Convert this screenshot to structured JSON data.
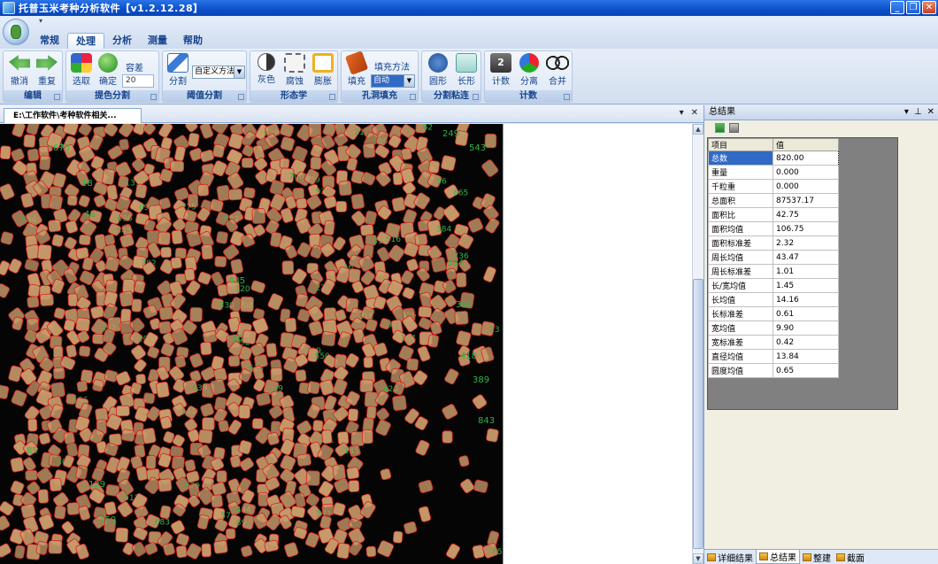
{
  "window": {
    "title": "托普玉米考种分析软件【v1.2.12.28】"
  },
  "menu_tabs": [
    {
      "label": "常规",
      "active": false
    },
    {
      "label": "处理",
      "active": true
    },
    {
      "label": "分析",
      "active": false
    },
    {
      "label": "测量",
      "active": false
    },
    {
      "label": "帮助",
      "active": false
    }
  ],
  "ribbon": {
    "edit": {
      "group": "编辑",
      "undo": "撤消",
      "redo": "重复"
    },
    "color_seg": {
      "group": "提色分割",
      "pick": "选取",
      "confirm": "确定",
      "tolerance_label": "容差",
      "tolerance_value": "20"
    },
    "threshold": {
      "group": "阈值分割",
      "split": "分割",
      "method": "自定义方法"
    },
    "morphology": {
      "group": "形态学",
      "gray": "灰色",
      "erode": "腐蚀",
      "dilate": "膨胀"
    },
    "hole_fill": {
      "group": "孔洞填充",
      "fill": "填充",
      "method_label": "填充方法",
      "method_value": "自动"
    },
    "split_stick": {
      "group": "分割粘连",
      "circle": "圆形",
      "rect": "长形"
    },
    "count": {
      "group": "计数",
      "count": "计数",
      "separate": "分离",
      "merge": "合并"
    }
  },
  "document": {
    "tab_label": "E:\\工作软件\\考种软件相关..."
  },
  "results_panel": {
    "title": "总结果",
    "columns": [
      "项目",
      "值"
    ],
    "rows": [
      {
        "key": "总数",
        "value": "820.00"
      },
      {
        "key": "重量",
        "value": "0.000"
      },
      {
        "key": "千粒重",
        "value": "0.000"
      },
      {
        "key": "总面积",
        "value": "87537.17"
      },
      {
        "key": "面积比",
        "value": "42.75"
      },
      {
        "key": "面积均值",
        "value": "106.75"
      },
      {
        "key": "面积标准差",
        "value": "2.32"
      },
      {
        "key": "周长均值",
        "value": "43.47"
      },
      {
        "key": "周长标准差",
        "value": "1.01"
      },
      {
        "key": "长/宽均值",
        "value": "1.45"
      },
      {
        "key": "长均值",
        "value": "14.16"
      },
      {
        "key": "长标准差",
        "value": "0.61"
      },
      {
        "key": "宽均值",
        "value": "9.90"
      },
      {
        "key": "宽标准差",
        "value": "0.42"
      },
      {
        "key": "直径均值",
        "value": "13.84"
      },
      {
        "key": "圆度均值",
        "value": "0.65"
      }
    ],
    "bottom_tabs": [
      "详细结果",
      "总结果",
      "整建",
      "截面"
    ]
  },
  "image_labels": [
    "249",
    "670",
    "543",
    "18",
    "46",
    "304",
    "390",
    "418",
    "435",
    "16",
    "389",
    "843",
    "85",
    "129",
    "150"
  ],
  "colors": {
    "titlebar": "#0a4fc8",
    "kernel": "#c79a6a",
    "outline": "#d42020",
    "label": "#2fb34a",
    "selection": "#316ac5"
  }
}
